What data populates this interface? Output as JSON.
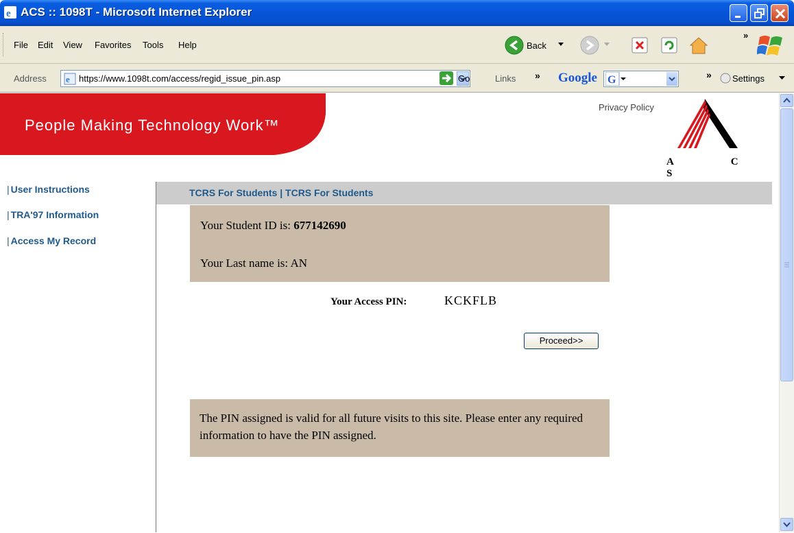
{
  "window": {
    "title": "ACS :: 1098T - Microsoft Internet Explorer"
  },
  "menu": {
    "items": [
      "File",
      "Edit",
      "View",
      "Favorites",
      "Tools",
      "Help"
    ]
  },
  "toolbar": {
    "back_label": "Back",
    "chevron": "»"
  },
  "address_bar": {
    "label": "Address",
    "url": "https://www.1098t.com/access/regid_issue_pin.asp",
    "go_label": "Go",
    "links_label": "Links",
    "google_label": "Google",
    "settings_label": "Settings"
  },
  "page": {
    "banner_text": "People Making Technology Work™",
    "privacy_link": "Privacy Policy",
    "logo_letters": "A C S",
    "sidebar": {
      "items": [
        {
          "label": "User Instructions"
        },
        {
          "label": "TRA'97 Information"
        },
        {
          "label": "Access My Record"
        }
      ]
    },
    "tab_strip_text": "TCRS For Students | TCRS For Students",
    "student_id_label": "Your Student ID is:",
    "student_id_value": "677142690",
    "last_name_label": "Your Last name is:",
    "last_name_value": "AN",
    "pin_label": "Your Access PIN:",
    "pin_value": "KCKFLB",
    "proceed_button": "Proceed>>",
    "note": "The PIN assigned is valid for all future visits to this site. Please enter any required information to have the PIN assigned."
  },
  "colors": {
    "banner_red": "#d9171f",
    "link_blue": "#1f5a8c",
    "info_box": "#c9bba8",
    "tab_strip": "#cccccc"
  }
}
